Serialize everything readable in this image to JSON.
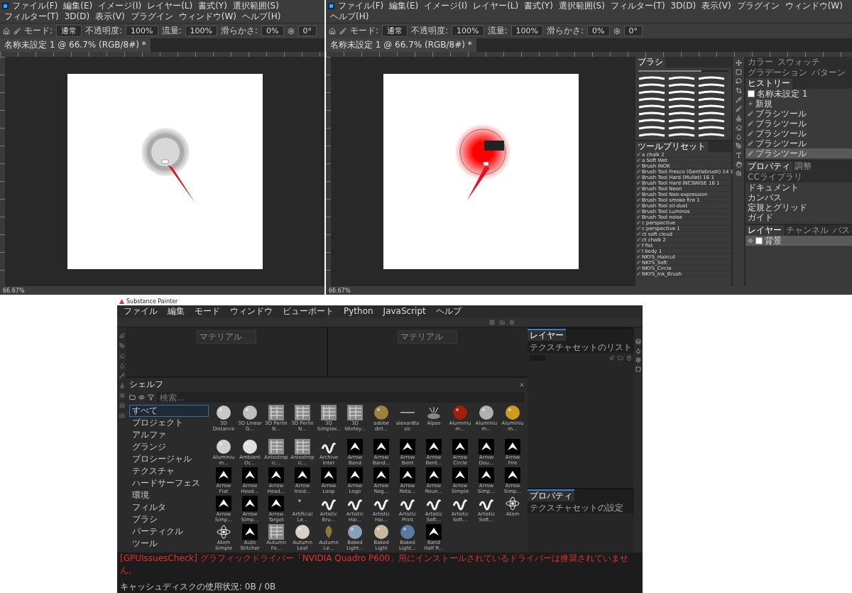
{
  "ps_windows": [
    {
      "menu": [
        "ファイル(F)",
        "編集(E)",
        "イメージ(I)",
        "レイヤー(L)",
        "書式(Y)",
        "選択範囲(S)",
        "フィルター(T)",
        "3D(D)",
        "表示(V)",
        "プラグイン",
        "ウィンドウ(W)",
        "ヘルプ(H)"
      ],
      "options": [
        {
          "label": "モード:",
          "value": "通常"
        },
        {
          "label": "不透明度:",
          "value": "100%"
        },
        {
          "label": "流量:",
          "value": "100%"
        },
        {
          "label": "滑らかさ:",
          "value": "0%"
        }
      ],
      "angle": "0°",
      "doc_tab": "名称未設定 1 @ 66.7% (RGB/8#) *",
      "status": "66.67%",
      "cursor": {
        "kind": "ring"
      }
    },
    {
      "menu": [
        "ファイル(F)",
        "編集(E)",
        "イメージ(I)",
        "レイヤー(L)",
        "書式(Y)",
        "選択範囲(S)",
        "フィルター(T)",
        "3D(D)",
        "表示(V)",
        "プラグイン",
        "ウィンドウ(W)",
        "ヘルプ(H)"
      ],
      "options": [
        {
          "label": "モード:",
          "value": "通常"
        },
        {
          "label": "不透明度:",
          "value": "100%"
        },
        {
          "label": "流量:",
          "value": "100%"
        },
        {
          "label": "滑らかさ:",
          "value": "0%"
        }
      ],
      "angle": "0°",
      "doc_tab": "名称未設定 1 @ 66.7% (RGB/8#) *",
      "status": "66.67%",
      "cursor": {
        "kind": "glow"
      }
    }
  ],
  "ps_panels": {
    "brushes": {
      "title": "ブラシ",
      "size": {
        "level": 0.7
      }
    },
    "tool_presets": {
      "title": "ツールプリセット",
      "items": [
        "a chalk 2",
        "a Soft Wet",
        "Brush INOK",
        "Brush Tool Fresco (Gentlebrush) 14 1",
        "Brush Tool Hard (Mullet) 16 1",
        "Brush Tool Hard INCSWISE 16 1",
        "Brush Tool Neon",
        "Brush Tool Neo-expression",
        "Brush Tool smoke fire 1",
        "Brush Tool oil-dust",
        "Brush Tool Luminos",
        "Brush Tool noise",
        "c perspective",
        "c perspective 1",
        "ct soft cloud",
        "ct chalk 2",
        "f fist",
        "l body 1",
        "NKYS_Haircut",
        "NKYS_Soft",
        "NKYS_Circle",
        "NKYS_Ink_Brush"
      ]
    },
    "history": {
      "tabs": [
        {
          "label": "カラー",
          "selected": false
        },
        {
          "label": "スウォッチ",
          "selected": false
        },
        {
          "label": "グラデーション",
          "selected": false
        },
        {
          "label": "パターン",
          "selected": false
        },
        {
          "label": "ヒストリー",
          "selected": true
        }
      ],
      "snapshot": "名称未設定 1",
      "items": [
        {
          "label": "新規",
          "kind": "new",
          "selected": false
        },
        {
          "label": "ブラシツール",
          "kind": "brush",
          "selected": false
        },
        {
          "label": "ブラシツール",
          "kind": "brush",
          "selected": false
        },
        {
          "label": "ブラシツール",
          "kind": "brush",
          "selected": false
        },
        {
          "label": "ブラシツール",
          "kind": "brush",
          "selected": false
        },
        {
          "label": "ブラシツール",
          "kind": "brush",
          "selected": true
        }
      ]
    },
    "properties": {
      "tabs": [
        {
          "label": "プロパティ",
          "selected": true
        },
        {
          "label": "調整",
          "selected": false
        },
        {
          "label": "CCライブラリ",
          "selected": false
        }
      ],
      "sections": [
        "ドキュメント",
        "カンバス",
        "定規とグリッド",
        "ガイド"
      ]
    },
    "layers": {
      "tabs": [
        {
          "label": "レイヤー",
          "selected": true
        },
        {
          "label": "チャンネル",
          "selected": false
        },
        {
          "label": "パス",
          "selected": false
        }
      ],
      "items": [
        {
          "name": "背景",
          "selected": true
        }
      ]
    }
  },
  "painter": {
    "title": "Substance Painter",
    "menu": [
      "ファイル",
      "編集",
      "モード",
      "ウィンドウ",
      "ビューポート",
      "Python",
      "JavaScript",
      "ヘルプ"
    ],
    "viewports": [
      {
        "field": "マテリアル"
      },
      {
        "field": "マテリアル"
      }
    ],
    "right_top_tabs": [
      {
        "label": "レイヤー",
        "selected": true
      },
      {
        "label": "テクスチャセットのリスト",
        "selected": false
      }
    ],
    "right_bottom_tabs": [
      {
        "label": "プロパティ",
        "selected": true
      },
      {
        "label": "テクスチャセットの設定",
        "selected": false
      }
    ],
    "shelf": {
      "title": "シェルフ",
      "placeholder": "検索...",
      "categories": [
        {
          "label": "すべて",
          "selected": true
        },
        {
          "label": "プロジェクト",
          "selected": false
        },
        {
          "label": "アルファ",
          "selected": false
        },
        {
          "label": "グランジ",
          "selected": false
        },
        {
          "label": "プロシージャル",
          "selected": false
        },
        {
          "label": "テクスチャ",
          "selected": false
        },
        {
          "label": "ハードサーフェス",
          "selected": false
        },
        {
          "label": "環境",
          "selected": false
        },
        {
          "label": "フィルタ",
          "selected": false
        },
        {
          "label": "ブラシ",
          "selected": false
        },
        {
          "label": "パーティクル",
          "selected": false
        },
        {
          "label": "ツール",
          "selected": false
        }
      ],
      "items": [
        {
          "label": "3D Distance",
          "kind": "sphere",
          "color": "#c8c8c8"
        },
        {
          "label": "3D Linear G...",
          "kind": "sphere",
          "color": "#bdbdbd"
        },
        {
          "label": "3D Perlin N...",
          "kind": "noise"
        },
        {
          "label": "3D Perlin N...",
          "kind": "noise"
        },
        {
          "label": "3D Simplex...",
          "kind": "noise"
        },
        {
          "label": "3D Worley...",
          "kind": "noise"
        },
        {
          "label": "adobe dirt...",
          "kind": "sphere",
          "color": "#a08040"
        },
        {
          "label": "alexanBasic",
          "kind": "line"
        },
        {
          "label": "Alpas",
          "kind": "burst"
        },
        {
          "label": "Aluminium...",
          "kind": "sphere",
          "color": "#a02010"
        },
        {
          "label": "Aluminium...",
          "kind": "sphere",
          "color": "#b0b0b0"
        },
        {
          "label": "Aluminium...",
          "kind": "sphere",
          "color": "#d09a20"
        },
        {
          "label": "Aluminium...",
          "kind": "sphere",
          "color": "#d0d0d0"
        },
        {
          "label": "Ambient Oc...",
          "kind": "sphere",
          "color": "#e0e0e0"
        },
        {
          "label": "Anisotropic...",
          "kind": "noise"
        },
        {
          "label": "Anisotropic...",
          "kind": "noise"
        },
        {
          "label": "Archive Inter",
          "kind": "stroke"
        },
        {
          "label": "Arrow Band",
          "kind": "arrow"
        },
        {
          "label": "Arrow Band...",
          "kind": "arrow"
        },
        {
          "label": "Arrow Bent",
          "kind": "arrow"
        },
        {
          "label": "Arrow Bent...",
          "kind": "arrow"
        },
        {
          "label": "Arrow Circle",
          "kind": "arrow"
        },
        {
          "label": "Arrow Dou...",
          "kind": "arrow"
        },
        {
          "label": "Arrow Fire",
          "kind": "arrow"
        },
        {
          "label": "Arrow Flat",
          "kind": "arrow"
        },
        {
          "label": "Arrow Head...",
          "kind": "arrow"
        },
        {
          "label": "Arrow Head...",
          "kind": "arrow"
        },
        {
          "label": "Arrow Insid...",
          "kind": "arrow"
        },
        {
          "label": "Arrow Loop",
          "kind": "arrow"
        },
        {
          "label": "Arrow Logo",
          "kind": "arrow"
        },
        {
          "label": "Arrow Neg...",
          "kind": "arrow"
        },
        {
          "label": "Arrow Rota...",
          "kind": "arrow"
        },
        {
          "label": "Arrow Roun...",
          "kind": "arrow"
        },
        {
          "label": "Arrow Simple",
          "kind": "arrow"
        },
        {
          "label": "Arrow Simp...",
          "kind": "arrow"
        },
        {
          "label": "Arrow Simp...",
          "kind": "arrow"
        },
        {
          "label": "Arrow Simp...",
          "kind": "arrow"
        },
        {
          "label": "Arrow Simp...",
          "kind": "arrow"
        },
        {
          "label": "Arrow Target",
          "kind": "arrow"
        },
        {
          "label": "Artificial Le...",
          "kind": "sphere",
          "color": "#2a2a2a"
        },
        {
          "label": "Artistic Bru...",
          "kind": "stroke"
        },
        {
          "label": "Artistic Hai...",
          "kind": "stroke"
        },
        {
          "label": "Artistic Hai...",
          "kind": "stroke"
        },
        {
          "label": "Artistic Print",
          "kind": "stroke"
        },
        {
          "label": "Artistic Soft...",
          "kind": "stroke"
        },
        {
          "label": "Artistic Soft...",
          "kind": "stroke"
        },
        {
          "label": "Artistic Soft...",
          "kind": "stroke"
        },
        {
          "label": "Atom",
          "kind": "atom"
        },
        {
          "label": "Atom Simple",
          "kind": "atom"
        },
        {
          "label": "Auto Stitcher",
          "kind": "arrow"
        },
        {
          "label": "Autumn Fo...",
          "kind": "noise"
        },
        {
          "label": "Autumn Leaf",
          "kind": "sphere",
          "color": "#d8d0c8"
        },
        {
          "label": "Autumn Le...",
          "kind": "leaf"
        },
        {
          "label": "Baked Light...",
          "kind": "sphere",
          "color": "#8aa0b8"
        },
        {
          "label": "Baked Light",
          "kind": "sphere",
          "color": "#c8b8a0"
        },
        {
          "label": "Baked Light...",
          "kind": "sphere",
          "color": "#5a7aa0"
        },
        {
          "label": "Band Half R...",
          "kind": "arrow"
        }
      ]
    },
    "status_message": "[GPUIssuesCheck] グラフィックドライバー「NVIDIA Quadro P600」用にインストールされているドライバーは推奨されていません。",
    "status_right": "キャッシュディスクの使用状況: 0B / 0B"
  }
}
